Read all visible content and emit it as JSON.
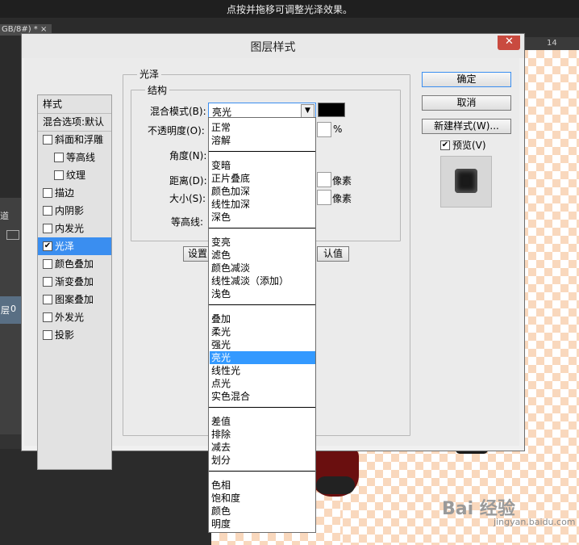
{
  "top_hint": "点按并拖移可调整光泽效果。",
  "doc_tab": "GB/8#) * ×",
  "ruler_label": "14",
  "left_panel": {
    "tab": "道",
    "layer_label": "层",
    "layer_num": "0"
  },
  "dialog": {
    "title": "图层样式",
    "close_symbol": "✕",
    "styles_header": "样式",
    "blend_defaults": "混合选项:默认",
    "styles": [
      {
        "label": "斜面和浮雕",
        "checked": false
      },
      {
        "label": "等高线",
        "checked": false
      },
      {
        "label": "纹理",
        "checked": false
      },
      {
        "label": "描边",
        "checked": false
      },
      {
        "label": "内阴影",
        "checked": false
      },
      {
        "label": "内发光",
        "checked": false
      },
      {
        "label": "光泽",
        "checked": true
      },
      {
        "label": "颜色叠加",
        "checked": false
      },
      {
        "label": "渐变叠加",
        "checked": false
      },
      {
        "label": "图案叠加",
        "checked": false
      },
      {
        "label": "外发光",
        "checked": false
      },
      {
        "label": "投影",
        "checked": false
      }
    ],
    "check_mark": "✔",
    "section_title": "光泽",
    "structure_title": "结构",
    "fields": {
      "blend_mode_label": "混合模式(B):",
      "blend_mode_value": "亮光",
      "opacity_label": "不透明度(O):",
      "opacity_unit": "%",
      "angle_label": "角度(N):",
      "distance_label": "距离(D):",
      "distance_unit": "像素",
      "size_label": "大小(S):",
      "size_unit": "像素",
      "contour_label": "等高线:"
    },
    "set_default_btn": "设置",
    "reset_default_btn": "认值",
    "ok_btn": "确定",
    "cancel_btn": "取消",
    "new_style_btn": "新建样式(W)...",
    "preview_label": "预览(V)",
    "preview_checked": true,
    "dropdown_arrow": "▼",
    "blend_options": [
      [
        "正常",
        "溶解"
      ],
      [
        "变暗",
        "正片叠底",
        "颜色加深",
        "线性加深",
        "深色"
      ],
      [
        "变亮",
        "滤色",
        "颜色减淡",
        "线性减淡（添加）",
        "浅色"
      ],
      [
        "叠加",
        "柔光",
        "强光",
        "亮光",
        "线性光",
        "点光",
        "实色混合"
      ],
      [
        "差值",
        "排除",
        "减去",
        "划分"
      ],
      [
        "色相",
        "饱和度",
        "颜色",
        "明度"
      ]
    ],
    "highlighted_option": "亮光"
  },
  "watermark": {
    "brand": "Bai 经验",
    "sub": "jingyan.baidu.com"
  }
}
